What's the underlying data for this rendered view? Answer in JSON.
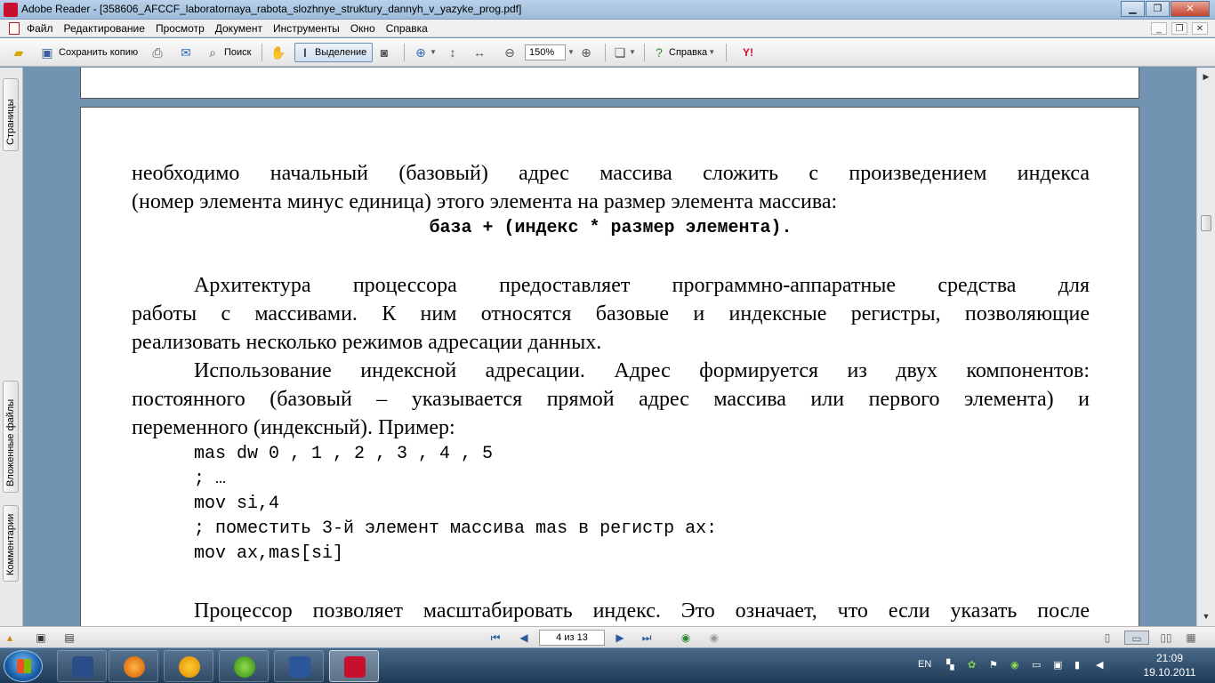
{
  "window": {
    "title": "Adobe Reader - [358606_AFCCF_laboratornaya_rabota_slozhnye_struktury_dannyh_v_yazyke_prog.pdf]"
  },
  "menu": [
    "Файл",
    "Редактирование",
    "Просмотр",
    "Документ",
    "Инструменты",
    "Окно",
    "Справка"
  ],
  "toolbar": {
    "save_copy": "Сохранить копию",
    "search": "Поиск",
    "select": "Выделение",
    "zoom": "150%",
    "help": "Справка"
  },
  "left_panel": {
    "tabs": [
      "Страницы",
      "Вложенные файлы",
      "Комментарии"
    ]
  },
  "document": {
    "line1": "необходимо начальный (базовый) адрес массива сложить с произведением индекса",
    "line2": "(номер элемента минус единица) этого элемента на размер элемента массива:",
    "formula": "база + (индекс * размер элемента).",
    "p2_l1": "Архитектура процессора предоставляет программно-аппаратные средства для",
    "p2_l2": "работы с массивами. К ним относятся базовые и индексные регистры, позволяющие",
    "p2_l3": "реализовать несколько режимов адресации данных.",
    "p3_l1": "Использование индексной адресации. Адрес формируется из двух компонентов:",
    "p3_l2": "постоянного (базовый – указывается прямой адрес массива или первого элемента) и",
    "p3_l3": "переменного (индексный).  Пример:",
    "code": [
      "mas dw 0 , 1 , 2 , 3 , 4 , 5",
      "; …",
      "mov si,4",
      "; поместить 3-й элемент массива mas в регистр ax:",
      "mov ax,mas[si]"
    ],
    "p4_l1": "Процессор позволяет масштабировать индекс. Это означает, что если указать после"
  },
  "status": {
    "page": "4 из 13"
  },
  "taskbar": {
    "lang": "EN",
    "time": "21:09",
    "date": "19.10.2011"
  }
}
